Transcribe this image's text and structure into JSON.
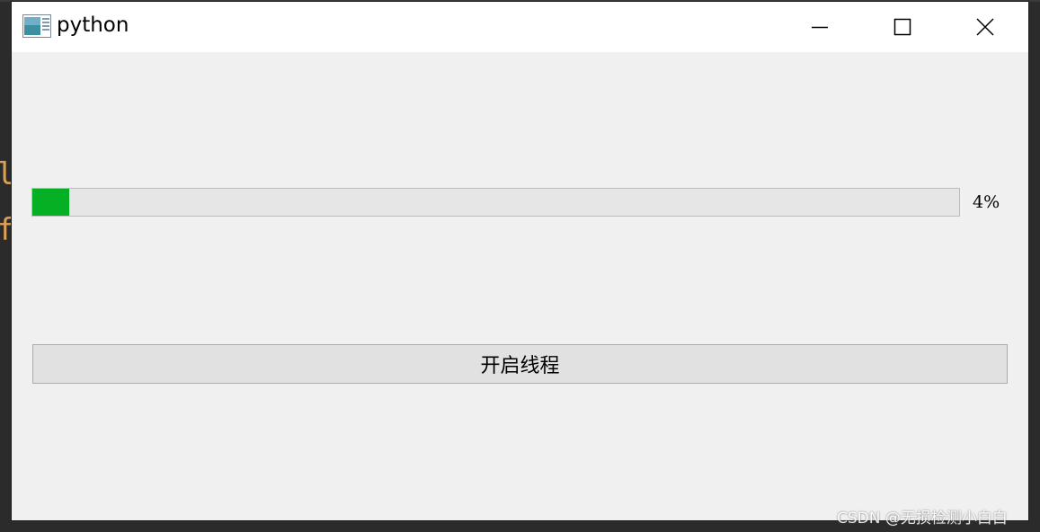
{
  "window": {
    "title": "python",
    "app_icon": "app-window-icon",
    "controls": {
      "minimize_icon": "minimize-icon",
      "maximize_icon": "maximize-icon",
      "close_icon": "close-icon"
    }
  },
  "progress": {
    "value": 4,
    "label": "4%",
    "fill_color": "#06b025"
  },
  "start_button": {
    "label": "开启线程"
  },
  "background": {
    "text_line1": "l",
    "text_line2": "f"
  },
  "watermark": "CSDN @无损检测小白白"
}
